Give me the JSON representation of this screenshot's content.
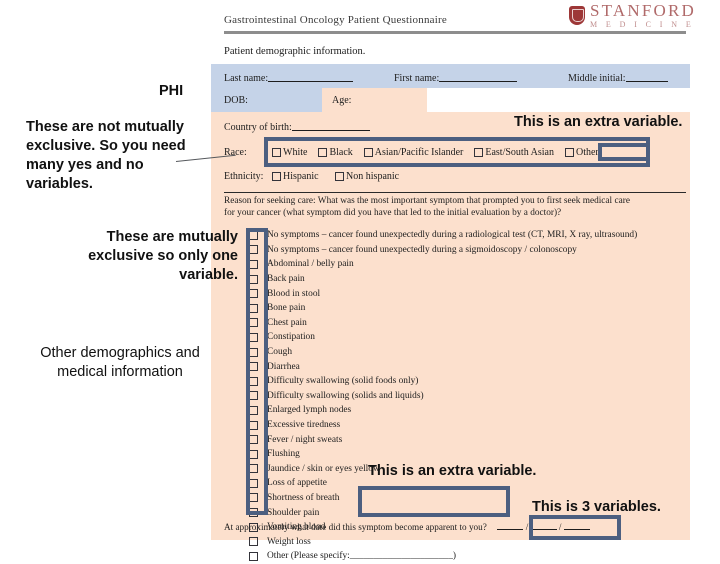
{
  "document": {
    "header_title": "Gastrointestinal Oncology Patient Questionnaire",
    "logo": {
      "word": "STANFORD",
      "sub": "M E D I C I N E"
    },
    "section_label": "Patient demographic information.",
    "fields": {
      "last_name": "Last name:",
      "first_name": "First name:",
      "middle_initial": "Middle initial:",
      "dob": "DOB:",
      "age": "Age:",
      "country_of_birth": "Country of birth:",
      "race": "Race:",
      "ethnicity": "Ethnicity:"
    },
    "race_options": [
      "White",
      "Black",
      "Asian/Pacific Islander",
      "East/South Asian",
      "Other"
    ],
    "ethnicity_options": [
      "Hispanic",
      "Non hispanic"
    ],
    "reason_line1": "Reason for seeking care:  What was the most important symptom that prompted you to first seek medical care",
    "reason_line2": "for your cancer (what symptom did you have that led to the initial evaluation by a doctor)?",
    "symptoms": [
      "No symptoms – cancer found unexpectedly during a radiological test (CT, MRI, X ray, ultrasound)",
      "No symptoms – cancer found unexpectedly during a sigmoidoscopy / colonoscopy",
      "Abdominal / belly pain",
      "Back pain",
      "Blood in stool",
      "Bone pain",
      "Chest pain",
      "Constipation",
      "Cough",
      "Diarrhea",
      "Difficulty swallowing (solid foods only)",
      "Difficulty swallowing (solids and liquids)",
      "Enlarged lymph nodes",
      "Excessive tiredness",
      "Fever / night sweats",
      "Flushing",
      "Jaundice / skin or eyes yellow",
      "Loss of appetite",
      "Shortness of breath",
      "Shoulder pain",
      "Vomiting blood",
      "Weight loss",
      "Other (Please specify:______________________)"
    ],
    "date_question": "At approximately what date did this symptom become apparent to you?"
  },
  "annotations": {
    "phi": "PHI",
    "not_mutually_exclusive": "These are not mutually exclusive. So you need many yes and no variables.",
    "mutually_exclusive": "These are mutually exclusive so only one variable.",
    "other_demographics": "Other demographics and medical information",
    "extra_variable_top": "This is an extra variable.",
    "extra_variable_bottom": "This is an extra variable.",
    "three_variables": "This is 3 variables."
  },
  "colors": {
    "callout_blue": "#4c5f80",
    "form_peach": "#fce0cd",
    "form_blue": "#c5d3e8",
    "stanford_red": "#8c1515"
  }
}
